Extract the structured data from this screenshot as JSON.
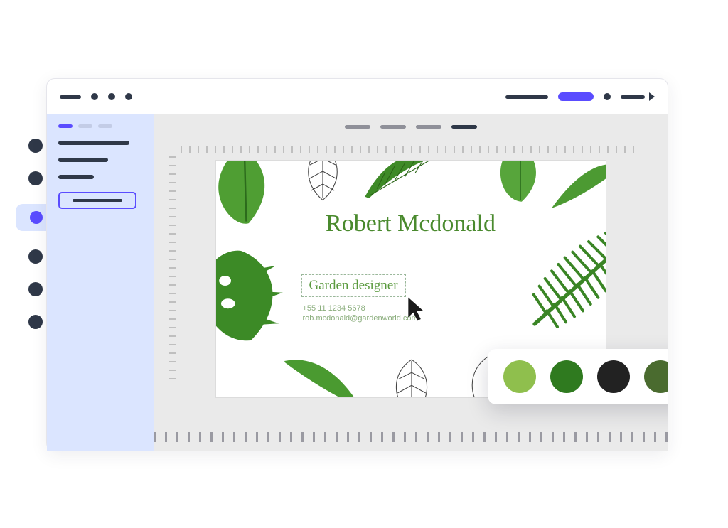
{
  "card": {
    "name": "Robert Mcdonald",
    "role": "Garden designer",
    "phone": "+55 11 1234 5678",
    "email": "rob.mcdonald@gardenworld.com"
  },
  "palette": {
    "swatches": [
      "#8fbf4d",
      "#2f7a1f",
      "#222222",
      "#4a6b2f"
    ]
  },
  "colors": {
    "accent": "#5a4cff",
    "ink": "#2f3848",
    "panel_bg": "#dbe5ff"
  },
  "sidebar": {
    "active_tool_index": 2,
    "tool_count": 6,
    "panel_active_tab": 0,
    "panel_tab_count": 3
  },
  "canvas": {
    "tab_count": 4,
    "active_tab_index": 3
  }
}
